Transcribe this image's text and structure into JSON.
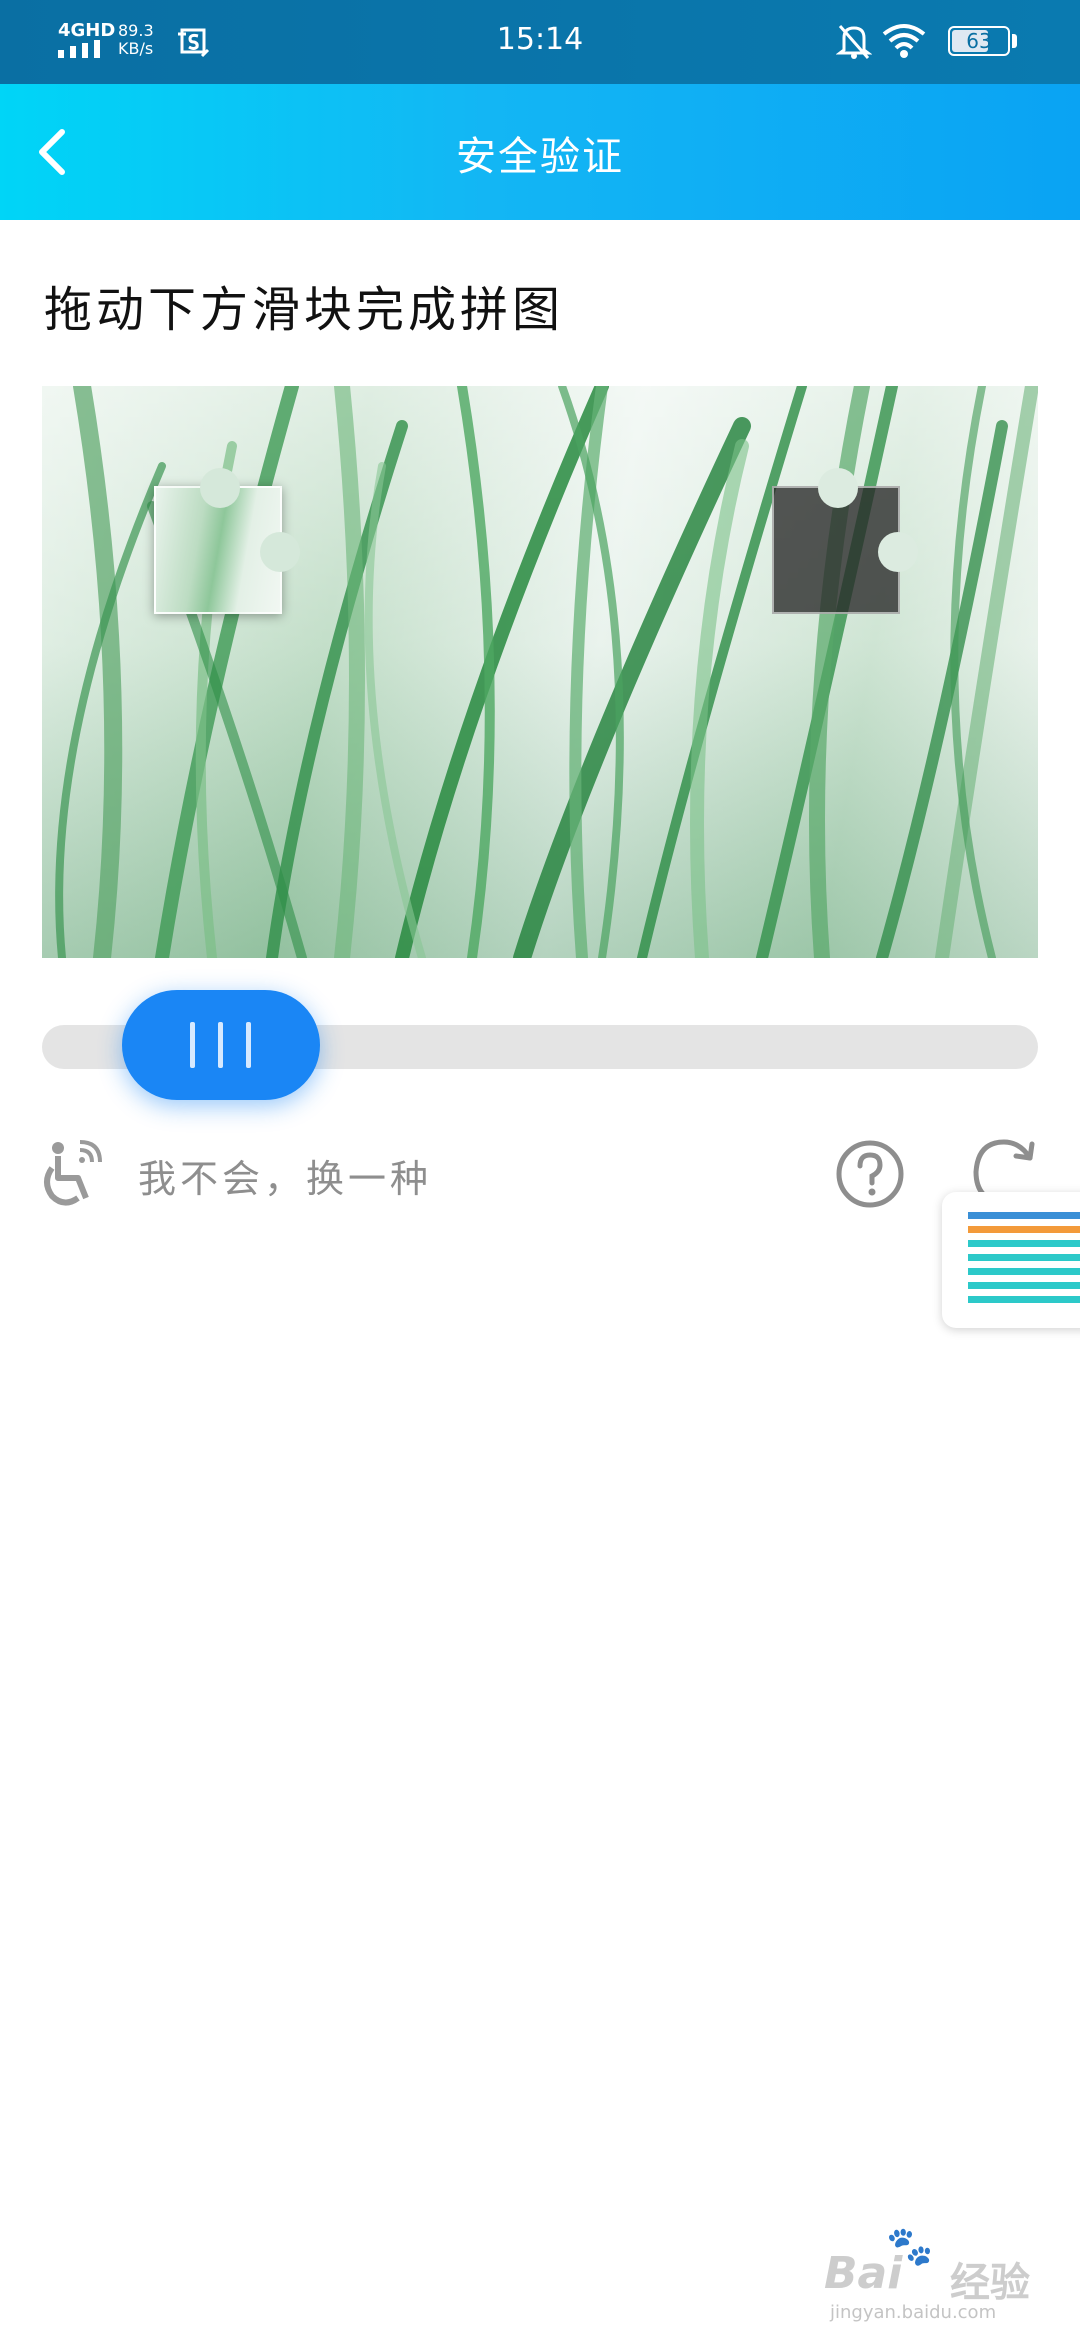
{
  "status_bar": {
    "network": "4GHD",
    "speed": "89.3",
    "speed_unit": "KB/s",
    "time": "15:14",
    "battery": "63"
  },
  "header": {
    "title": "安全验证"
  },
  "captcha": {
    "instruction": "拖动下方滑块完成拼图",
    "switch_text": "我不会，换一种"
  },
  "watermark": {
    "brand": "Bai",
    "brand_cn": "经验",
    "url": "jingyan.baidu.com"
  },
  "icons": {
    "back": "chevron-left-icon",
    "accessibility": "wheelchair-audio-icon",
    "help": "question-circle-icon",
    "refresh": "refresh-icon"
  },
  "colors": {
    "accent": "#1a86f5",
    "nav_gradient_start": "#00d5f7",
    "nav_gradient_end": "#0aa3f3",
    "status_bar": "#0a6fa3"
  }
}
